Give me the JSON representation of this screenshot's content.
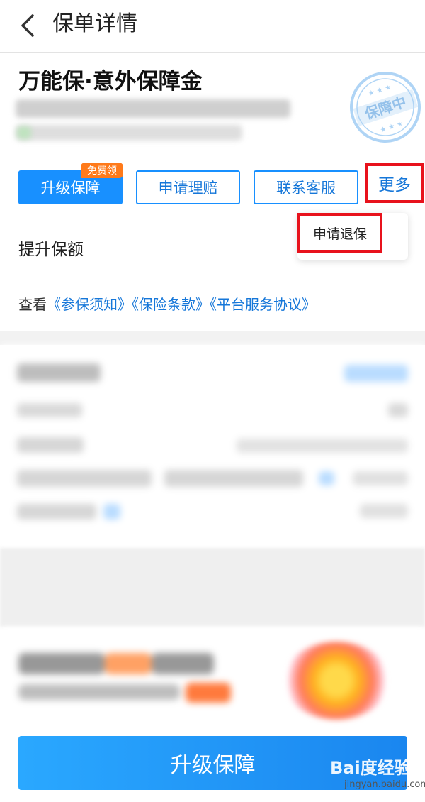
{
  "header": {
    "title": "保单详情",
    "back_icon": "chevron-left-icon"
  },
  "policy": {
    "product_name": "万能保·意外保障金",
    "status_stamp": "保障中"
  },
  "actions": {
    "upgrade_label": "升级保障",
    "upgrade_badge": "免费领",
    "claim_label": "申请理赔",
    "service_label": "联系客服",
    "more_label": "更多"
  },
  "dropdown": {
    "items": [
      {
        "label": "申请退保"
      }
    ]
  },
  "section": {
    "label": "提升保额"
  },
  "links": {
    "prefix": "查看",
    "items": [
      "《参保须知》",
      "《保险条款》",
      "《平台服务协议》"
    ]
  },
  "bottom": {
    "button_label": "升级保障"
  },
  "watermark": {
    "brand": "Bai度经验",
    "url": "jingyan.baidu.com"
  },
  "colors": {
    "accent": "#1890ff",
    "badge": "#ff7a1a",
    "highlight_box": "#e8121c"
  }
}
